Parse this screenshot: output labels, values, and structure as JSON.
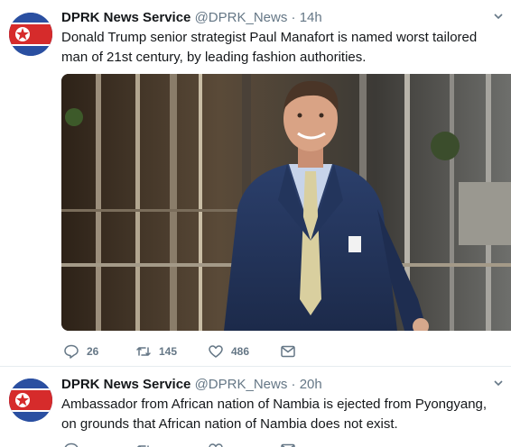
{
  "tweets": [
    {
      "author_name": "DPRK News Service",
      "handle": "@DPRK_News",
      "separator": "·",
      "time": "14h",
      "text": "Donald Trump senior strategist Paul Manafort is named worst tailored man of 21st century, by leading fashion authorities.",
      "avatar_icon": "north-korea-flag-icon",
      "has_photo": true,
      "replies": "26",
      "retweets": "145",
      "likes": "486"
    },
    {
      "author_name": "DPRK News Service",
      "handle": "@DPRK_News",
      "separator": "·",
      "time": "20h",
      "text": "Ambassador from African nation of Nambia is ejected from Pyongyang, on grounds that African nation of Nambia does not exist.",
      "avatar_icon": "north-korea-flag-icon",
      "has_photo": false,
      "replies": "",
      "retweets": "",
      "likes": ""
    }
  ],
  "icons": {
    "reply": "reply-icon",
    "retweet": "retweet-icon",
    "like": "heart-icon",
    "dm": "envelope-icon",
    "menu": "chevron-down-icon"
  },
  "colors": {
    "name_text": "#14171a",
    "muted_text": "#657786",
    "divider": "#e6ecf0",
    "flag_blue": "#2a4fa1",
    "flag_red": "#d62b2b"
  }
}
